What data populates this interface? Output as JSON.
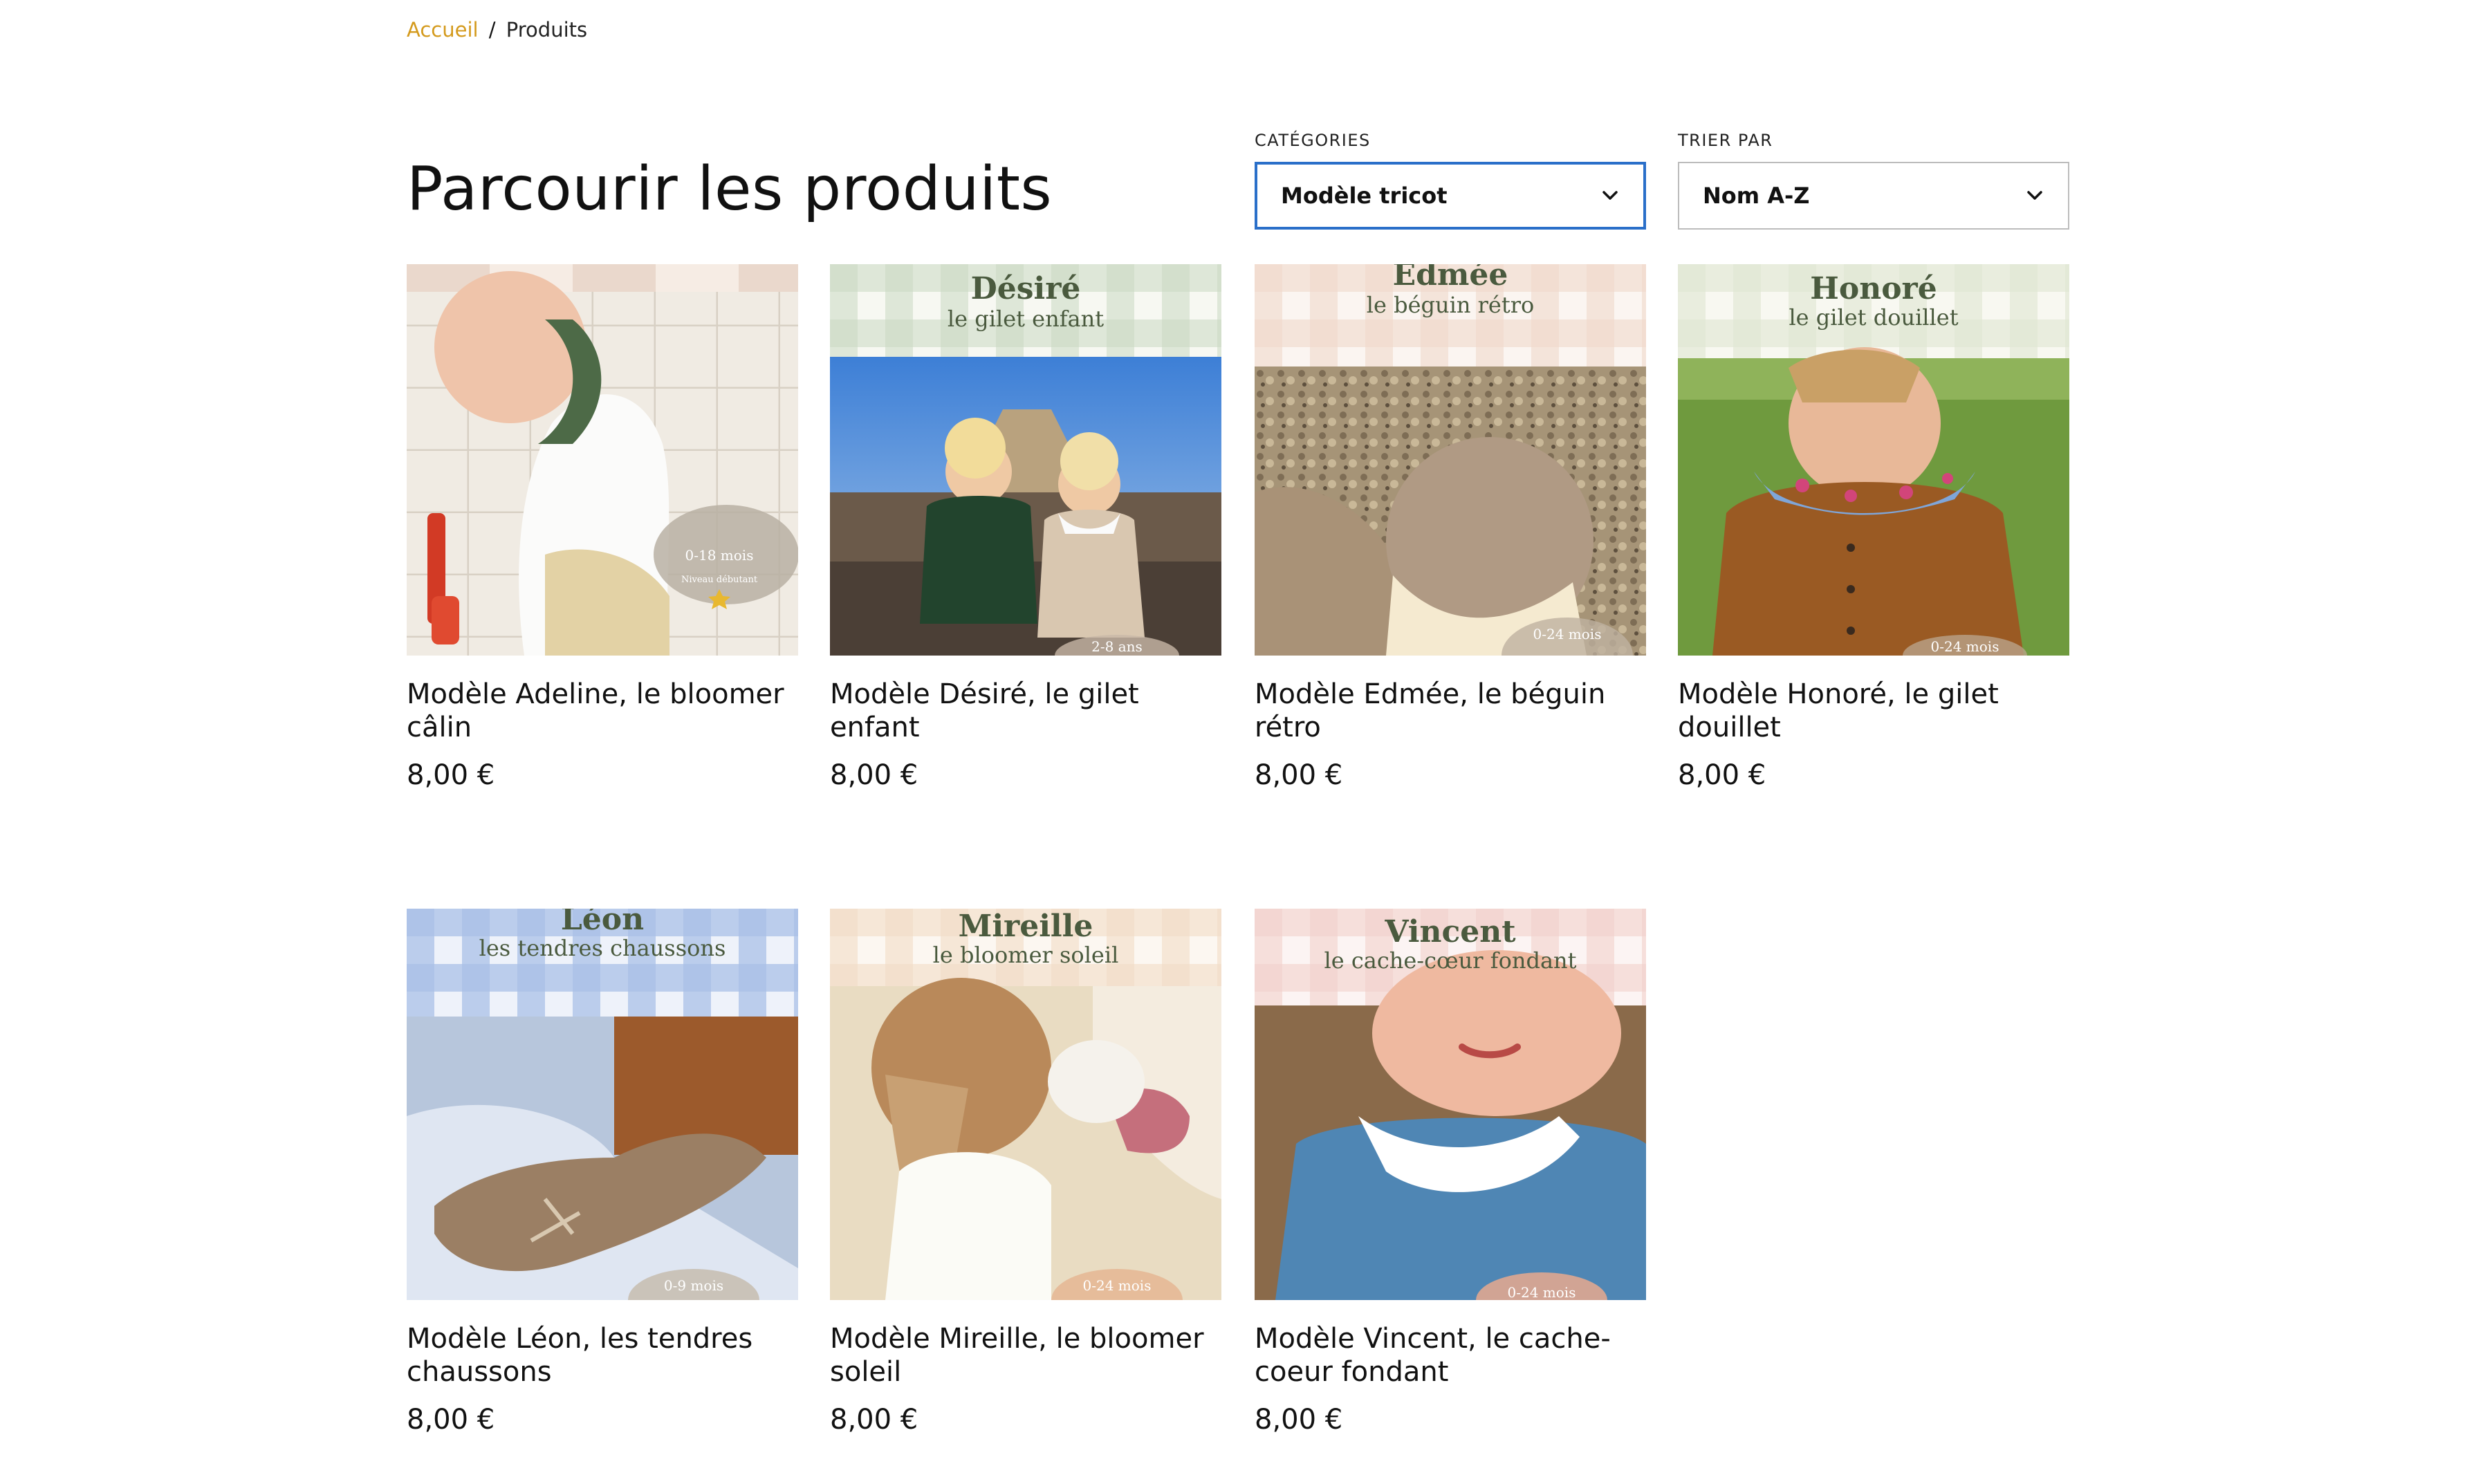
{
  "breadcrumb": {
    "home": "Accueil",
    "separator": "/",
    "current": "Produits"
  },
  "page": {
    "title": "Parcourir les produits"
  },
  "filters": {
    "categories": {
      "label": "CATÉGORIES",
      "selected": "Modèle tricot"
    },
    "sort": {
      "label": "TRIER PAR",
      "selected": "Nom A-Z"
    }
  },
  "products": [
    {
      "name": "Modèle Adeline, le bloomer câlin",
      "price": "8,00 €",
      "image": {
        "title": "",
        "subtitle": "",
        "badge": "0-18 mois",
        "badge2": "Niveau débutant",
        "theme": "beige"
      }
    },
    {
      "name": "Modèle Désiré, le gilet enfant",
      "price": "8,00 €",
      "image": {
        "title": "Désiré",
        "subtitle": "le gilet enfant",
        "badge": "2-8 ans",
        "theme": "green"
      }
    },
    {
      "name": "Modèle Edmée, le béguin rétro",
      "price": "8,00 €",
      "image": {
        "title": "Edmée",
        "subtitle": "le béguin rétro",
        "badge": "0-24 mois",
        "theme": "pink"
      }
    },
    {
      "name": "Modèle Honoré, le gilet douillet",
      "price": "8,00 €",
      "image": {
        "title": "Honoré",
        "subtitle": "le gilet douillet",
        "badge": "0-24 mois",
        "theme": "sage"
      }
    },
    {
      "name": "Modèle Léon, les tendres chaussons",
      "price": "8,00 €",
      "image": {
        "title": "Léon",
        "subtitle": "les tendres chaussons",
        "badge": "0-9 mois",
        "theme": "blue"
      }
    },
    {
      "name": "Modèle Mireille, le bloomer soleil",
      "price": "8,00 €",
      "image": {
        "title": "Mireille",
        "subtitle": "le bloomer soleil",
        "badge": "0-24 mois",
        "theme": "peach"
      }
    },
    {
      "name": "Modèle Vincent, le cache-coeur fondant",
      "price": "8,00 €",
      "image": {
        "title": "Vincent",
        "subtitle": "le cache-cœur fondant",
        "badge": "0-24 mois",
        "theme": "rose"
      }
    }
  ],
  "colors": {
    "accent": "#d49a1c",
    "focus_border": "#2a6fc9",
    "banner_text": "#4a5a3e"
  }
}
